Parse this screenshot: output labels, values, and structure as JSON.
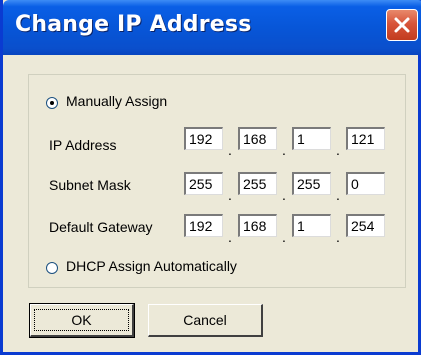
{
  "window": {
    "title": "Change IP Address"
  },
  "options": {
    "manual_label": "Manually Assign",
    "dhcp_label": "DHCP Assign Automatically",
    "selected": "manual"
  },
  "fields": {
    "ip_label": "IP Address",
    "ip": [
      "192",
      "168",
      "1",
      "121"
    ],
    "subnet_label": "Subnet Mask",
    "subnet": [
      "255",
      "255",
      "255",
      "0"
    ],
    "gateway_label": "Default Gateway",
    "gateway": [
      "192",
      "168",
      "1",
      "254"
    ],
    "separator": "."
  },
  "buttons": {
    "ok_label": "OK",
    "cancel_label": "Cancel"
  },
  "colors": {
    "titlebar": "#0756d8",
    "close": "#d8553a",
    "dialog_bg": "#ece9d8"
  },
  "icons": {
    "close": "close-icon"
  }
}
